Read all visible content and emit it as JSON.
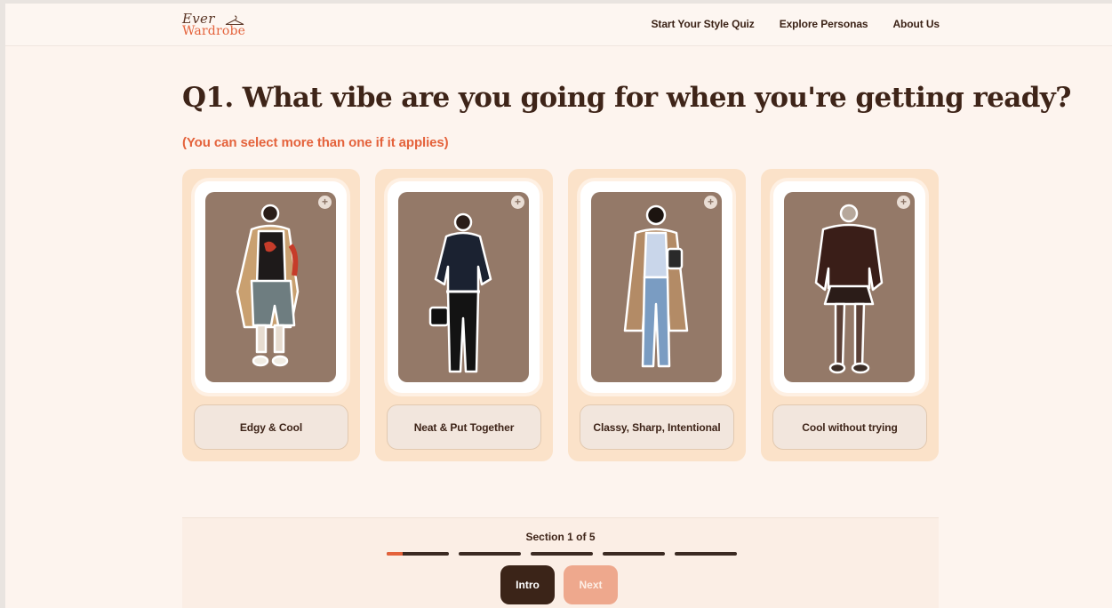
{
  "brand": {
    "line1": "Ever",
    "line2": "Wardrobe",
    "accent": "#e4623b",
    "dark": "#3e2418"
  },
  "nav": [
    {
      "label": "Start Your Style Quiz"
    },
    {
      "label": "Explore Personas"
    },
    {
      "label": "About Us"
    }
  ],
  "question": {
    "title": "Q1. What vibe are you going for when you're getting ready?",
    "subtitle": "(You can select more than one if it applies)"
  },
  "options": [
    {
      "label": "Edgy & Cool",
      "add_icon": "plus-icon"
    },
    {
      "label": "Neat & Put Together",
      "add_icon": "plus-icon"
    },
    {
      "label": "Classy, Sharp, Intentional",
      "add_icon": "plus-icon"
    },
    {
      "label": "Cool without trying",
      "add_icon": "plus-icon"
    }
  ],
  "progress": {
    "label": "Section 1 of 5",
    "current_section": 1,
    "total_sections": 5,
    "first_segment_fraction": 0.25
  },
  "buttons": {
    "back": "Intro",
    "next": "Next"
  }
}
